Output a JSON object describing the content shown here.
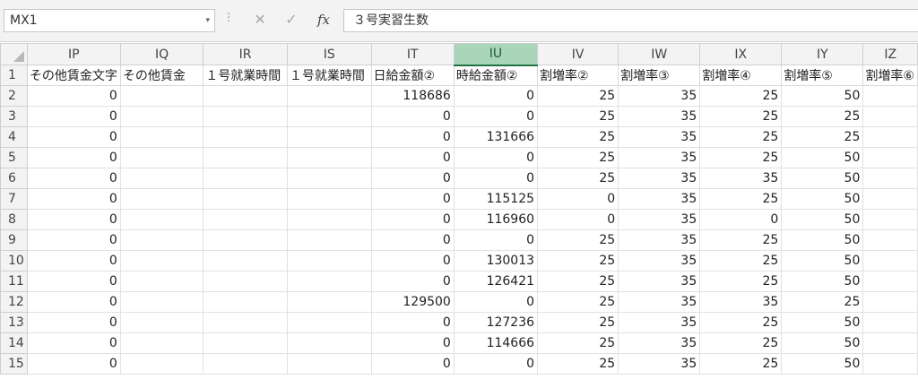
{
  "formula_bar": {
    "name_box": "MX1",
    "content": "３号実習生数"
  },
  "columns": [
    "IP",
    "IQ",
    "IR",
    "IS",
    "IT",
    "IU",
    "IV",
    "IW",
    "IX",
    "IY",
    "IZ"
  ],
  "selected_column": "IU",
  "header_row": [
    "その他賃金文字",
    "その他賃金",
    "１号就業時間",
    "１号就業時間",
    "日給金額②",
    "時給金額②",
    "割増率②",
    "割増率③",
    "割増率④",
    "割増率⑤",
    "割増率⑥"
  ],
  "rows": [
    {
      "n": "1"
    },
    {
      "n": "2",
      "v": [
        "0",
        "",
        "",
        "",
        "118686",
        "0",
        "25",
        "35",
        "25",
        "50",
        ""
      ]
    },
    {
      "n": "3",
      "v": [
        "0",
        "",
        "",
        "",
        "0",
        "0",
        "25",
        "35",
        "25",
        "25",
        ""
      ]
    },
    {
      "n": "4",
      "v": [
        "0",
        "",
        "",
        "",
        "0",
        "131666",
        "25",
        "35",
        "25",
        "25",
        ""
      ]
    },
    {
      "n": "5",
      "v": [
        "0",
        "",
        "",
        "",
        "0",
        "0",
        "25",
        "35",
        "25",
        "50",
        ""
      ]
    },
    {
      "n": "6",
      "v": [
        "0",
        "",
        "",
        "",
        "0",
        "0",
        "25",
        "35",
        "35",
        "50",
        ""
      ]
    },
    {
      "n": "7",
      "v": [
        "0",
        "",
        "",
        "",
        "0",
        "115125",
        "0",
        "35",
        "25",
        "50",
        ""
      ]
    },
    {
      "n": "8",
      "v": [
        "0",
        "",
        "",
        "",
        "0",
        "116960",
        "0",
        "35",
        "0",
        "50",
        ""
      ]
    },
    {
      "n": "9",
      "v": [
        "0",
        "",
        "",
        "",
        "0",
        "0",
        "25",
        "35",
        "25",
        "50",
        ""
      ]
    },
    {
      "n": "10",
      "v": [
        "0",
        "",
        "",
        "",
        "0",
        "130013",
        "25",
        "35",
        "25",
        "50",
        ""
      ]
    },
    {
      "n": "11",
      "v": [
        "0",
        "",
        "",
        "",
        "0",
        "126421",
        "25",
        "35",
        "25",
        "50",
        ""
      ]
    },
    {
      "n": "12",
      "v": [
        "0",
        "",
        "",
        "",
        "129500",
        "0",
        "25",
        "35",
        "35",
        "25",
        ""
      ]
    },
    {
      "n": "13",
      "v": [
        "0",
        "",
        "",
        "",
        "0",
        "127236",
        "25",
        "35",
        "25",
        "50",
        ""
      ]
    },
    {
      "n": "14",
      "v": [
        "0",
        "",
        "",
        "",
        "0",
        "114666",
        "25",
        "35",
        "25",
        "50",
        ""
      ]
    },
    {
      "n": "15",
      "v": [
        "0",
        "",
        "",
        "",
        "0",
        "0",
        "25",
        "35",
        "25",
        "50",
        ""
      ]
    }
  ]
}
